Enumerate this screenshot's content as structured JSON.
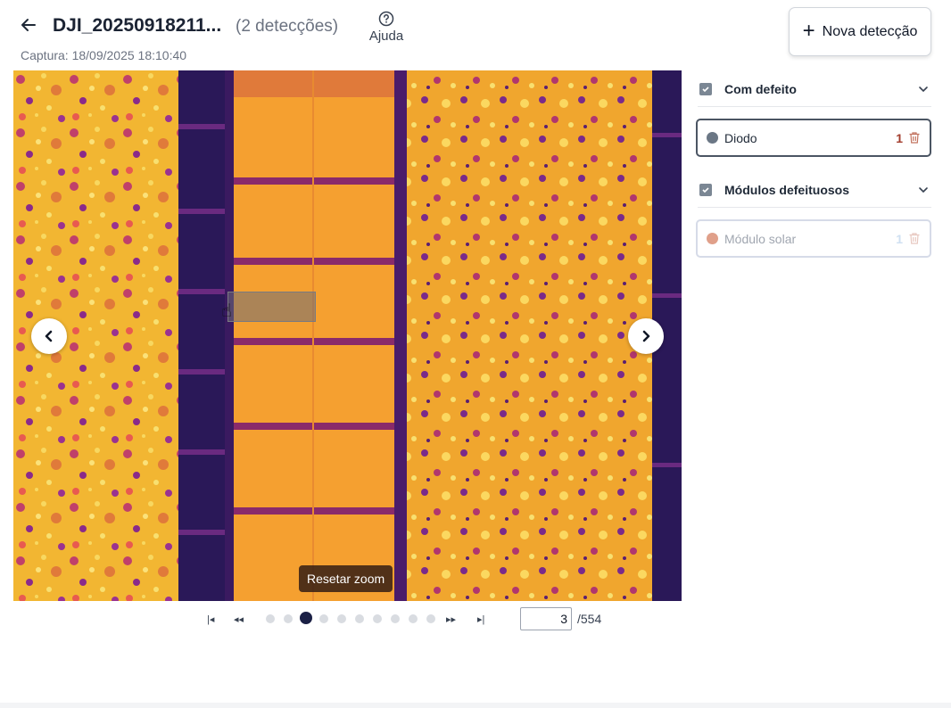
{
  "header": {
    "title": "DJI_20250918211...",
    "detections_count": "(2 detecções)",
    "help_label": "Ajuda",
    "capture": "Captura: 18/09/2025 18:10:40",
    "new_detection_label": "Nova detecção"
  },
  "viewer": {
    "reset_zoom_label": "Resetar zoom"
  },
  "pagination": {
    "first": "|◂",
    "prev": "◂◂",
    "next": "▸▸",
    "last": "▸|",
    "dot_count": 10,
    "active_dot_index": 2,
    "current_page": "3",
    "total_pages": "/554"
  },
  "panel": {
    "groups": [
      {
        "title": "Com defeito",
        "checked": true,
        "items": [
          {
            "label": "Diodo",
            "count": "1",
            "dot_color": "#6b7785",
            "label_color": "#1f2937",
            "count_color": "#a23c2c",
            "selected": true
          }
        ]
      },
      {
        "title": "Módulos defeituosos",
        "checked": true,
        "items": [
          {
            "label": "Módulo solar",
            "count": "1",
            "dot_color": "#e0a08a",
            "label_color": "#a0a6b0",
            "count_color": "#cfe0f2",
            "selected": false
          }
        ]
      }
    ]
  },
  "colors": {
    "accent_dark": "#1b2045",
    "thermal_hot": "#f4c430",
    "thermal_warm": "#f5a623",
    "thermal_cool": "#7a2a8a",
    "thermal_cold": "#2a1858"
  },
  "icons": [
    "back-arrow-icon",
    "help-circle-icon",
    "plus-icon",
    "chevron-left-icon",
    "chevron-right-icon",
    "hand-cursor-icon",
    "checkbox-icon",
    "chevron-down-icon",
    "trash-icon"
  ]
}
